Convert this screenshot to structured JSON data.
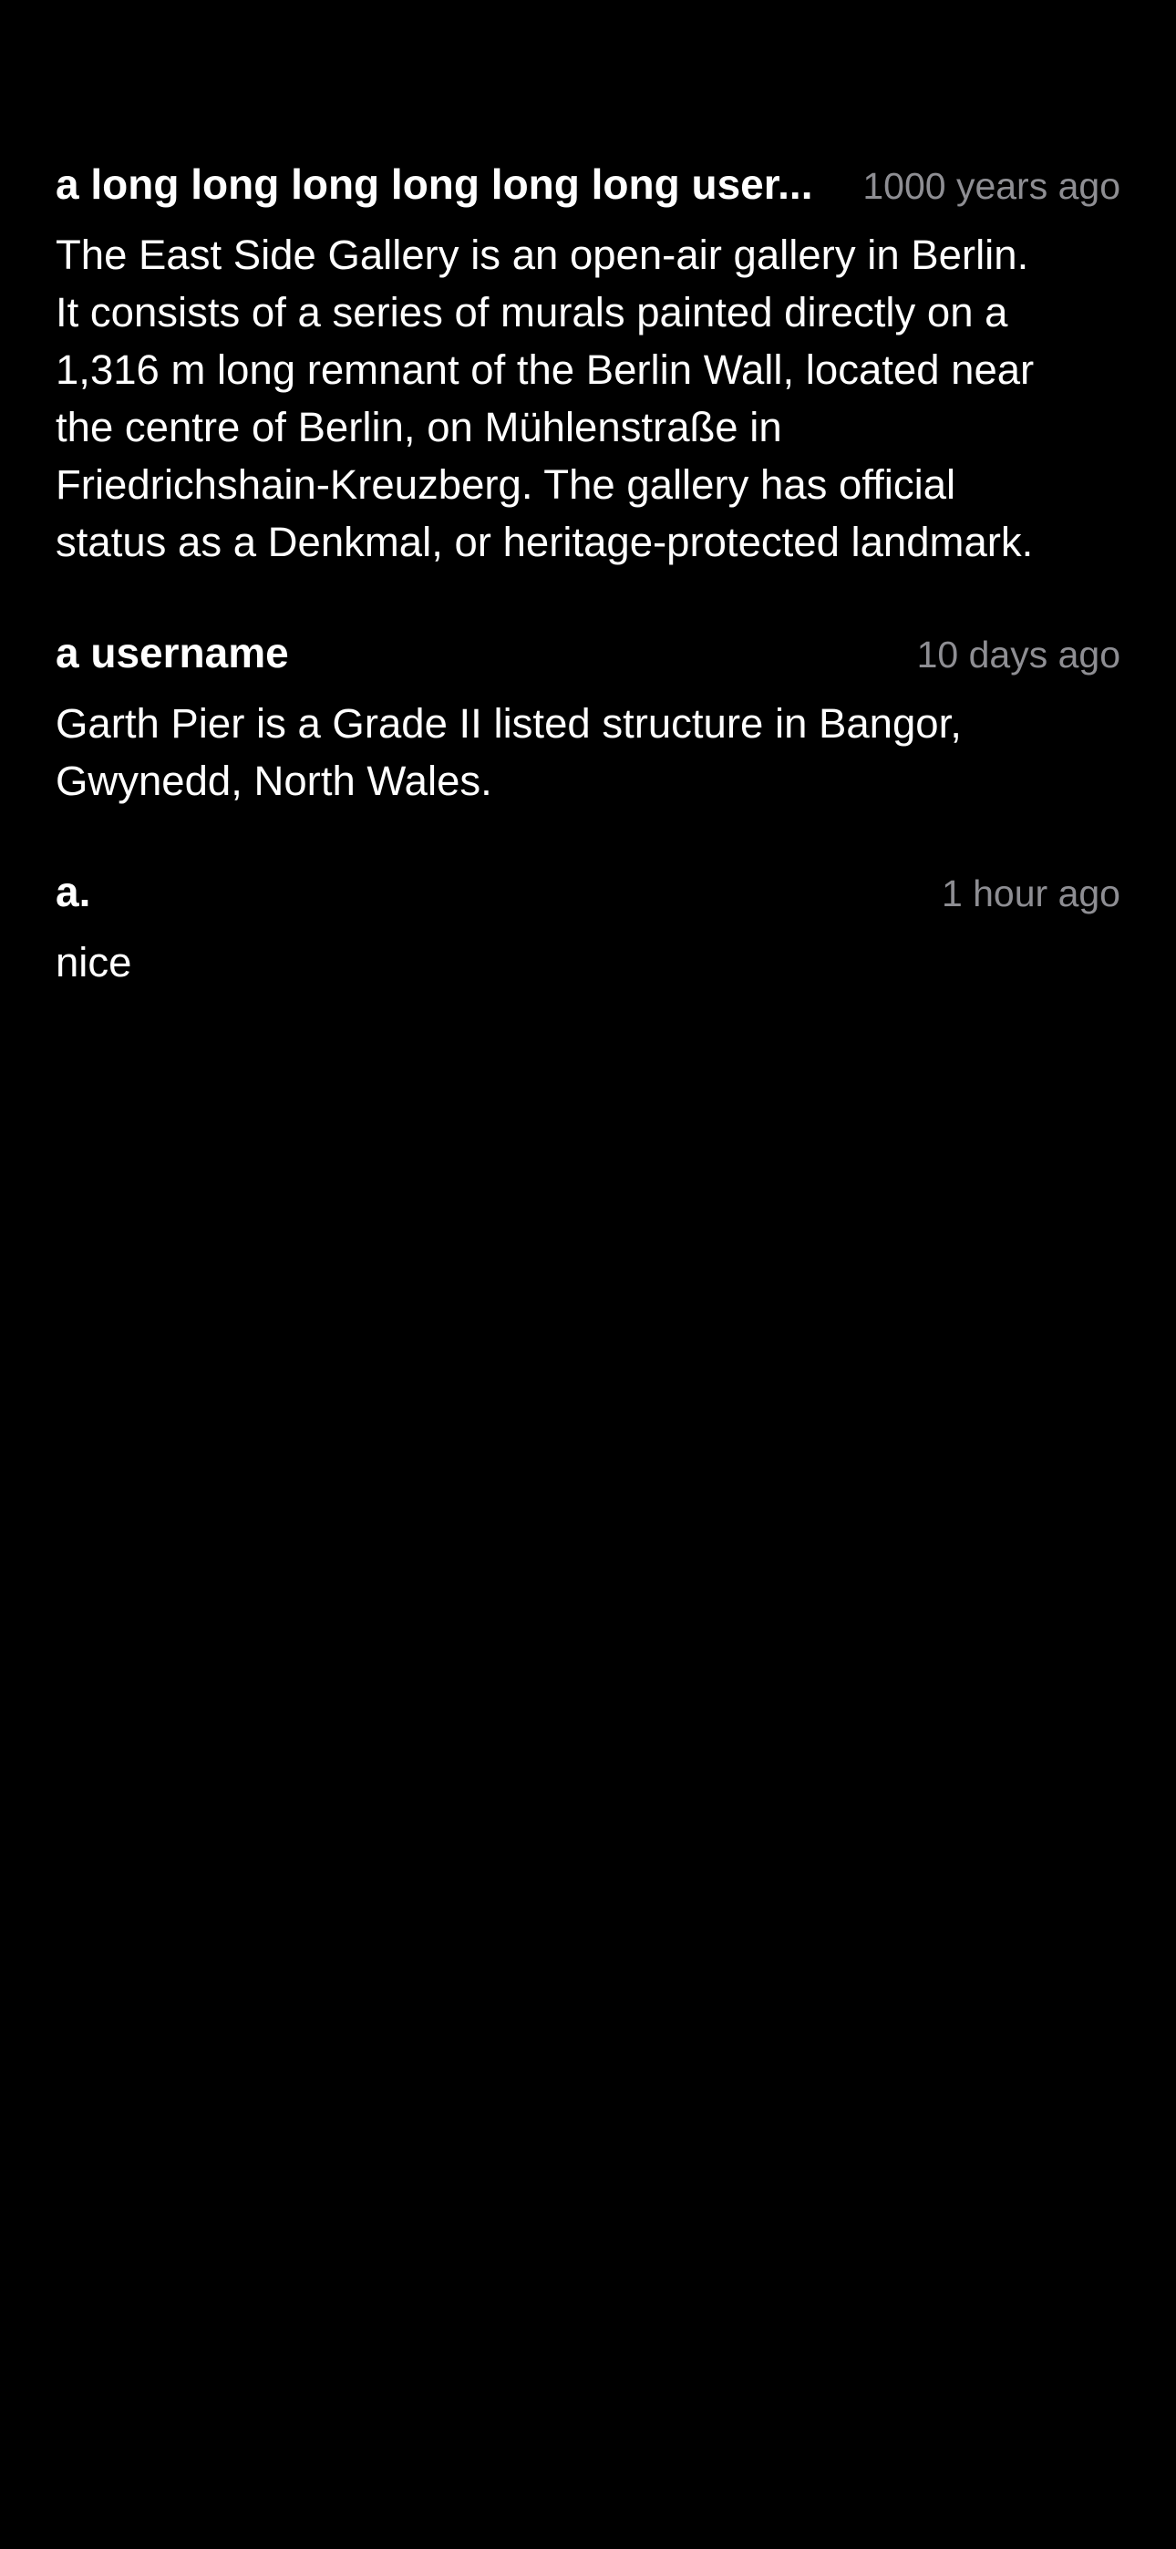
{
  "colors": {
    "background": "#000000",
    "text": "#ffffff",
    "timestamp": "#8e8e93"
  },
  "comments": [
    {
      "username": "a long long long long long long user...",
      "timestamp": "1000 years ago",
      "body_lines": [
        "The East Side Gallery is an open-air gallery in Berlin.",
        "It consists of a series of murals painted directly on a",
        "1,316 m long remnant of the Berlin Wall, located near",
        "the centre of Berlin, on Mühlenstraße in",
        "Friedrichshain-Kreuzberg. The gallery has official",
        "status as a Denkmal, or heritage-protected landmark."
      ]
    },
    {
      "username": "a username",
      "timestamp": "10 days ago",
      "body_lines": [
        "Garth Pier is a Grade II listed structure in Bangor,",
        "Gwynedd, North Wales."
      ]
    },
    {
      "username": "a.",
      "timestamp": "1 hour ago",
      "body_lines": [
        "nice"
      ]
    }
  ]
}
